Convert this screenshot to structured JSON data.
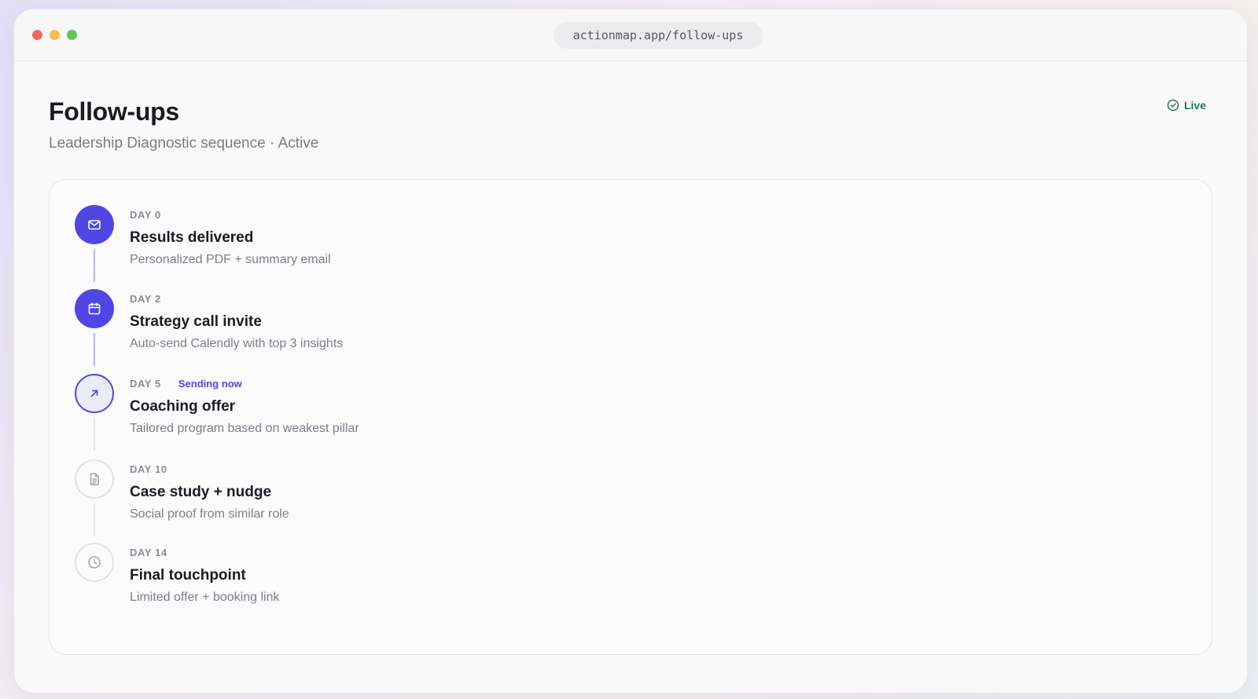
{
  "browser": {
    "url": "actionmap.app/follow-ups"
  },
  "header": {
    "title": "Follow-ups",
    "subtitle": "Leadership Diagnostic sequence · Active",
    "status_label": "Live"
  },
  "colors": {
    "accent": "#4f46e5",
    "live": "#1f7a52"
  },
  "sequence": [
    {
      "day": "DAY 0",
      "title": "Results delivered",
      "description": "Personalized PDF + summary email",
      "state": "done",
      "icon": "mail-icon"
    },
    {
      "day": "DAY 2",
      "title": "Strategy call invite",
      "description": "Auto-send Calendly with top 3 insights",
      "state": "done",
      "icon": "calendar-icon"
    },
    {
      "day": "DAY 5",
      "status": "Sending now",
      "title": "Coaching offer",
      "description": "Tailored program based on weakest pillar",
      "state": "current",
      "icon": "arrow-up-right-icon"
    },
    {
      "day": "DAY 10",
      "title": "Case study + nudge",
      "description": "Social proof from similar role",
      "state": "pending",
      "icon": "document-icon"
    },
    {
      "day": "DAY 14",
      "title": "Final touchpoint",
      "description": "Limited offer + booking link",
      "state": "pending",
      "icon": "clock-icon"
    }
  ]
}
